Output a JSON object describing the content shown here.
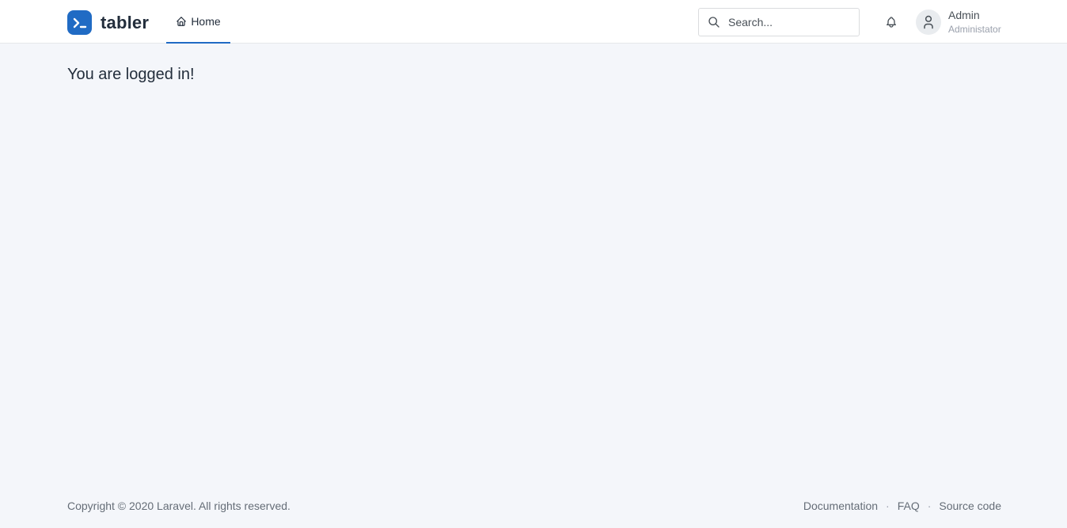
{
  "header": {
    "brand_name": "tabler",
    "nav": {
      "home_label": "Home"
    },
    "search": {
      "placeholder": "Search...",
      "value": ""
    },
    "user": {
      "name": "Admin",
      "role": "Administator"
    }
  },
  "main": {
    "message": "You are logged in!"
  },
  "footer": {
    "copyright": "Copyright © 2020 Laravel. All rights reserved.",
    "links": {
      "documentation": "Documentation",
      "faq": "FAQ",
      "source_code": "Source code"
    },
    "separator": "·"
  },
  "icons": {
    "brand": "terminal-icon",
    "home": "home-icon",
    "search": "search-icon",
    "notifications": "bell-icon",
    "avatar": "user-icon"
  },
  "colors": {
    "accent": "#206bc4",
    "background": "#f4f6fa",
    "header_bg": "#ffffff"
  }
}
